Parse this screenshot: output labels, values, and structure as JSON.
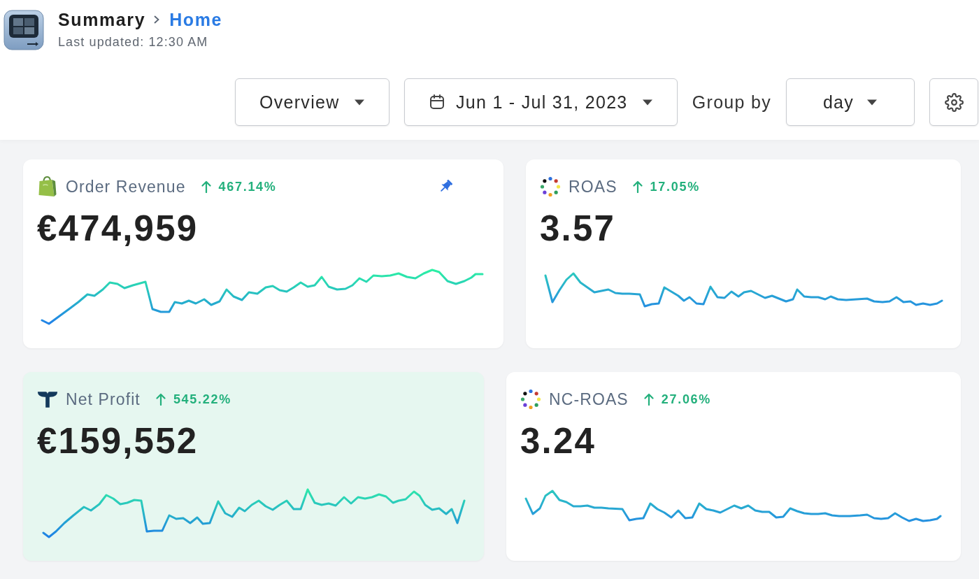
{
  "header": {
    "title": "Summary",
    "breadcrumb": "Home",
    "last_updated": "Last updated: 12:30 AM"
  },
  "toolbar": {
    "view": "Overview",
    "date_range": "Jun 1 - Jul 31, 2023",
    "group_by_label": "Group by",
    "group_by": "day"
  },
  "cards": [
    {
      "title": "Order Revenue",
      "increasing": true,
      "change": "467.14%",
      "value": "€474,959",
      "pinned": true,
      "highlighted": false
    },
    {
      "title": "ROAS",
      "increasing": true,
      "change": "17.05%",
      "value": "3.57",
      "pinned": false,
      "highlighted": false
    },
    {
      "title": "Net Profit",
      "increasing": true,
      "change": "545.22%",
      "value": "€159,552",
      "pinned": false,
      "highlighted": true
    },
    {
      "title": "NC-ROAS",
      "increasing": true,
      "change": "27.06%",
      "value": "3.24",
      "pinned": false,
      "highlighted": false
    }
  ]
}
